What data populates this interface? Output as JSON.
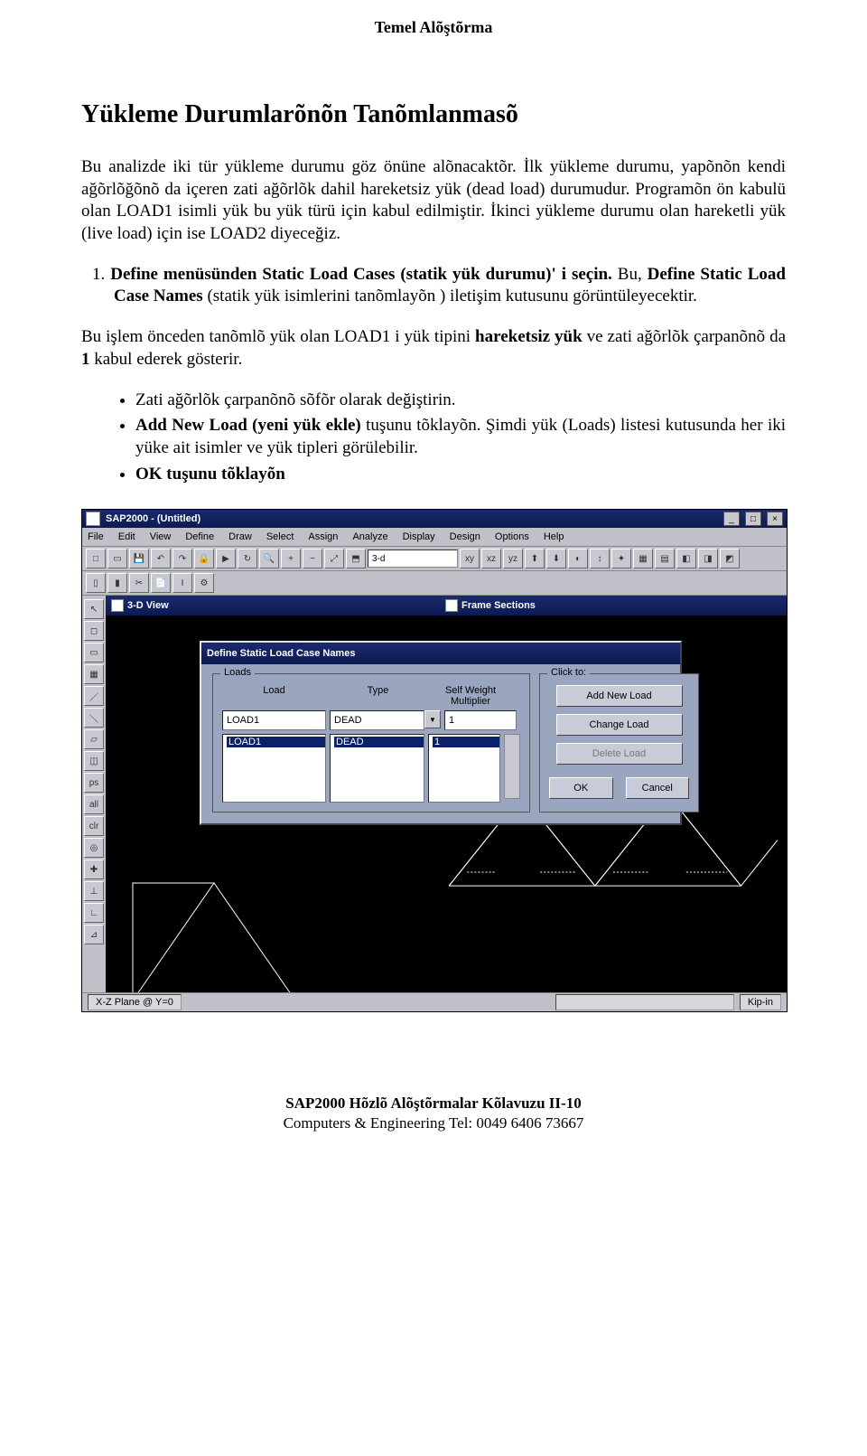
{
  "doc": {
    "header": "Temel Alõştõrma",
    "section_title": "Yükleme Durumlarõnõn Tanõmlanmasõ",
    "para1": "Bu analizde iki tür yükleme durumu göz önüne alõnacaktõr. İlk yükleme durumu, yapõnõn kendi ağõrlõğõnõ da içeren zati ağõrlõk dahil hareketsiz yük (dead load) durumudur. Programõn ön kabulü olan LOAD1 isimli yük bu yük türü için kabul edilmiştir. İkinci yükleme durumu olan hareketli yük (live load) için ise LOAD2 diyeceğiz.",
    "num1_prefix": "1.  ",
    "num1_part_a": "Define menüsünden Static Load Cases (statik yük durumu)' i seçin.",
    "num1_part_b": " Bu, ",
    "num1_bold_b": "Define Static  Load Case Names",
    "num1_part_c": " (statik yük isimlerini tanõmlayõn ) iletişim kutusunu görüntüleyecektir.",
    "para2_a": "Bu işlem önceden tanõmlõ yük olan LOAD1 i yük tipini ",
    "para2_bold1": "hareketsiz yük",
    "para2_b": " ve zati ağõrlõk çarpanõnõ da ",
    "para2_bold2": "1",
    "para2_c": " kabul ederek gösterir.",
    "bullet1": "Zati ağõrlõk çarpanõnõ sõfõr olarak değiştirin.",
    "bullet2_bold": "Add New Load (yeni yük ekle)",
    "bullet2_rest": " tuşunu tõklayõn. Şimdi yük (Loads) listesi kutusunda her iki yüke ait isimler ve yük tipleri görülebilir.",
    "bullet3_bold": "OK tuşunu tõklayõn",
    "footer_title": "SAP2000 Hõzlõ Alõştõrmalar Kõlavuzu   II-10",
    "footer_sub": "Computers & Engineering  Tel: 0049 6406 73667"
  },
  "app": {
    "title": "SAP2000 - (Untitled)",
    "menus": [
      "File",
      "Edit",
      "View",
      "Define",
      "Draw",
      "Select",
      "Assign",
      "Analyze",
      "Display",
      "Design",
      "Options",
      "Help"
    ],
    "view_left_title": "3-D View",
    "view_right_title": "Frame Sections",
    "status_left": "X-Z Plane @ Y=0",
    "status_right": "Kip-in",
    "toolbar_combo": "3-d"
  },
  "dialog": {
    "title": "Define Static Load Case Names",
    "group_loads": "Loads",
    "group_click": "Click to:",
    "col_load": "Load",
    "col_type": "Type",
    "col_mult_line1": "Self Weight",
    "col_mult_line2": "Multiplier",
    "input_load": "LOAD1",
    "input_type": "DEAD",
    "input_mult": "1",
    "list_load": "LOAD1",
    "list_type": "DEAD",
    "list_mult": "1",
    "btn_add": "Add New Load",
    "btn_change": "Change Load",
    "btn_delete": "Delete Load",
    "btn_ok": "OK",
    "btn_cancel": "Cancel"
  }
}
